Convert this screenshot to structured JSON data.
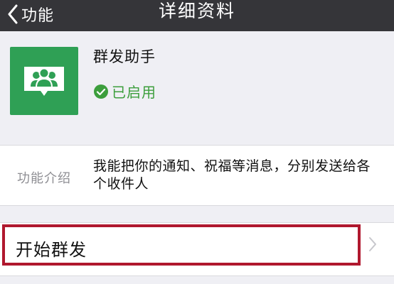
{
  "navbar": {
    "back_label": "功能",
    "title": "详细资料"
  },
  "profile": {
    "name": "群发助手",
    "status": "已启用",
    "avatar_icon": "group-people-icon",
    "status_icon": "check-circle-icon",
    "colors": {
      "avatar_bg": "#2fa055",
      "status": "#3c9e3c",
      "navbar_bg": "#353539"
    }
  },
  "intro": {
    "label": "功能介绍",
    "text": "我能把你的通知、祝福等消息，分别发送给各个收件人"
  },
  "action": {
    "label": "开始群发",
    "highlight_color": "#b0182e",
    "chevron_icon": "chevron-right-icon"
  }
}
